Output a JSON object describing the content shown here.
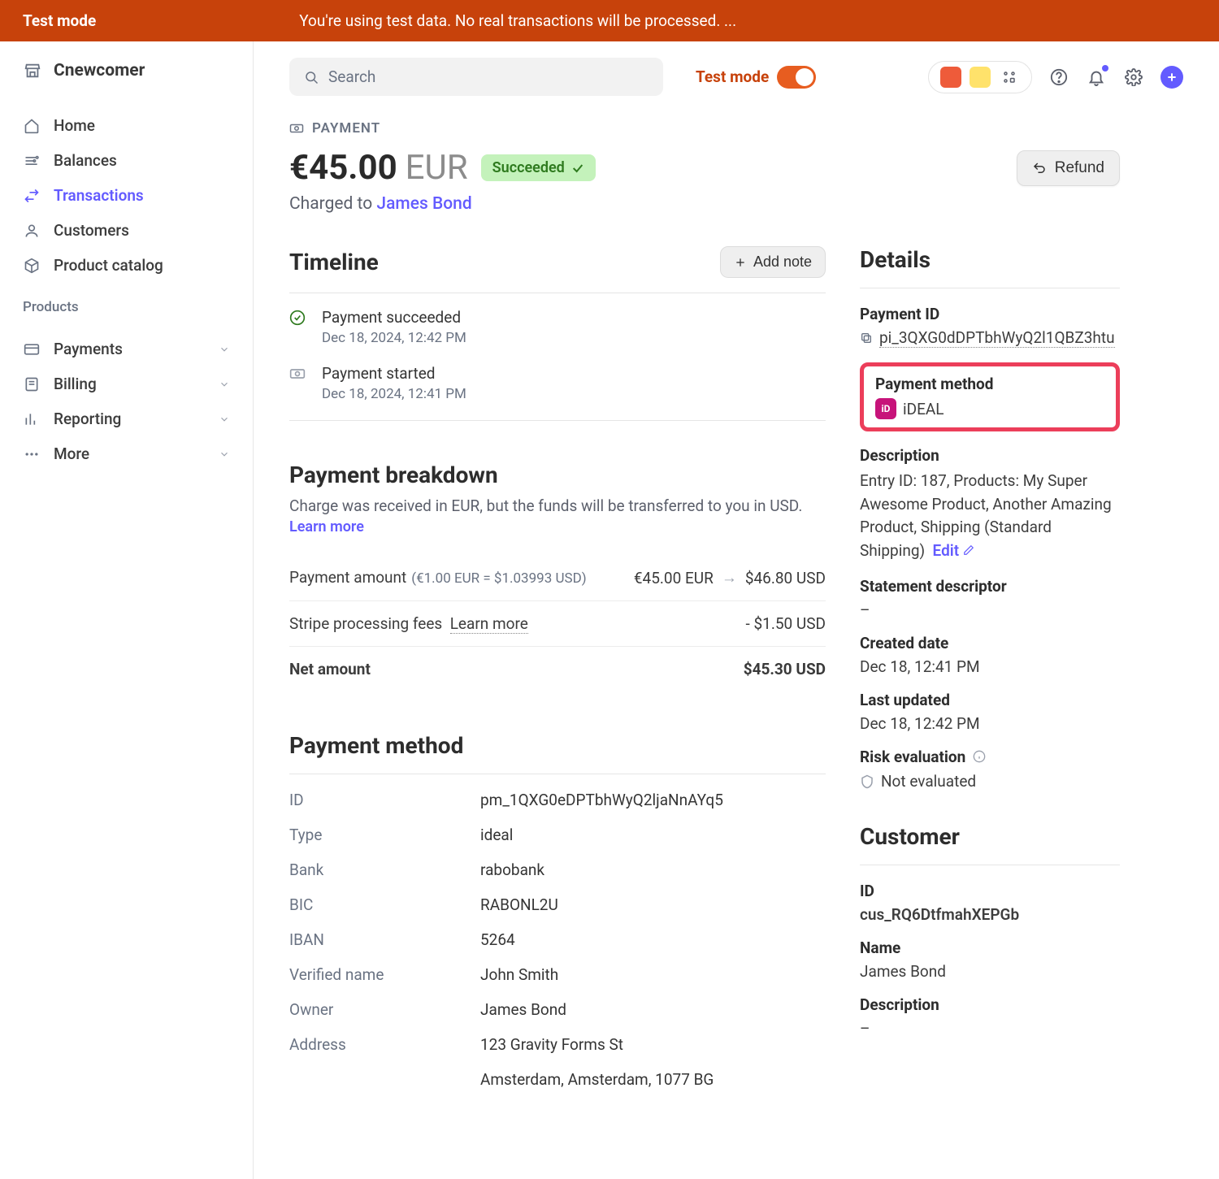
{
  "banner": {
    "title": "Test mode",
    "message": "You're using test data. No real transactions will be processed. ..."
  },
  "org": {
    "name": "Cnewcomer"
  },
  "nav": {
    "primary": [
      {
        "label": "Home"
      },
      {
        "label": "Balances"
      },
      {
        "label": "Transactions"
      },
      {
        "label": "Customers"
      },
      {
        "label": "Product catalog"
      }
    ],
    "section_label": "Products",
    "products": [
      {
        "label": "Payments"
      },
      {
        "label": "Billing"
      },
      {
        "label": "Reporting"
      },
      {
        "label": "More"
      }
    ]
  },
  "topbar": {
    "search_placeholder": "Search",
    "testmode_label": "Test mode"
  },
  "header": {
    "section": "PAYMENT",
    "amount": "€45.00",
    "currency": "EUR",
    "status": "Succeeded",
    "charged_to_prefix": "Charged to ",
    "charged_to_name": "James Bond",
    "refund_label": "Refund"
  },
  "timeline": {
    "title": "Timeline",
    "add_note": "Add note",
    "items": [
      {
        "text": "Payment succeeded",
        "time": "Dec 18, 2024, 12:42 PM"
      },
      {
        "text": "Payment started",
        "time": "Dec 18, 2024, 12:41 PM"
      }
    ]
  },
  "breakdown": {
    "title": "Payment breakdown",
    "note": "Charge was received in EUR, but the funds will be transferred to you in USD.",
    "learn_more": "Learn more",
    "rows": [
      {
        "label": "Payment amount",
        "sublabel": "(€1.00 EUR = $1.03993 USD)",
        "left_amount": "€45.00 EUR",
        "right_amount": "$46.80 USD"
      },
      {
        "label": "Stripe processing fees",
        "link": "Learn more",
        "right_amount": "- $1.50 USD"
      },
      {
        "label": "Net amount",
        "right_amount": "$45.30 USD",
        "bold": true
      }
    ]
  },
  "payment_method": {
    "title": "Payment method",
    "rows": [
      {
        "k": "ID",
        "v": "pm_1QXG0eDPTbhWyQ2ljaNnAYq5"
      },
      {
        "k": "Type",
        "v": "ideal"
      },
      {
        "k": "Bank",
        "v": "rabobank"
      },
      {
        "k": "BIC",
        "v": "RABONL2U"
      },
      {
        "k": "IBAN",
        "v": "5264"
      },
      {
        "k": "Verified name",
        "v": "John Smith"
      },
      {
        "k": "Owner",
        "v": "James Bond"
      },
      {
        "k": "Address",
        "v": "123 Gravity Forms St"
      },
      {
        "k": "",
        "v": "Amsterdam, Amsterdam, 1077 BG"
      }
    ]
  },
  "details": {
    "title": "Details",
    "payment_id_label": "Payment ID",
    "payment_id": "pi_3QXG0dDPTbhWyQ2l1QBZ3htu",
    "pm_label": "Payment method",
    "pm_value": "iDEAL",
    "description_label": "Description",
    "description": "Entry ID: 187, Products: My Super Awesome Product, Another Amazing Product, Shipping (Standard Shipping)",
    "edit": "Edit",
    "statement_label": "Statement descriptor",
    "statement_value": "–",
    "created_label": "Created date",
    "created_value": "Dec 18, 12:41 PM",
    "updated_label": "Last updated",
    "updated_value": "Dec 18, 12:42 PM",
    "risk_label": "Risk evaluation",
    "risk_value": "Not evaluated"
  },
  "customer": {
    "title": "Customer",
    "id_label": "ID",
    "id_value": "cus_RQ6DtfmahXEPGb",
    "name_label": "Name",
    "name_value": "James Bond",
    "description_label": "Description",
    "description_value": "–"
  }
}
